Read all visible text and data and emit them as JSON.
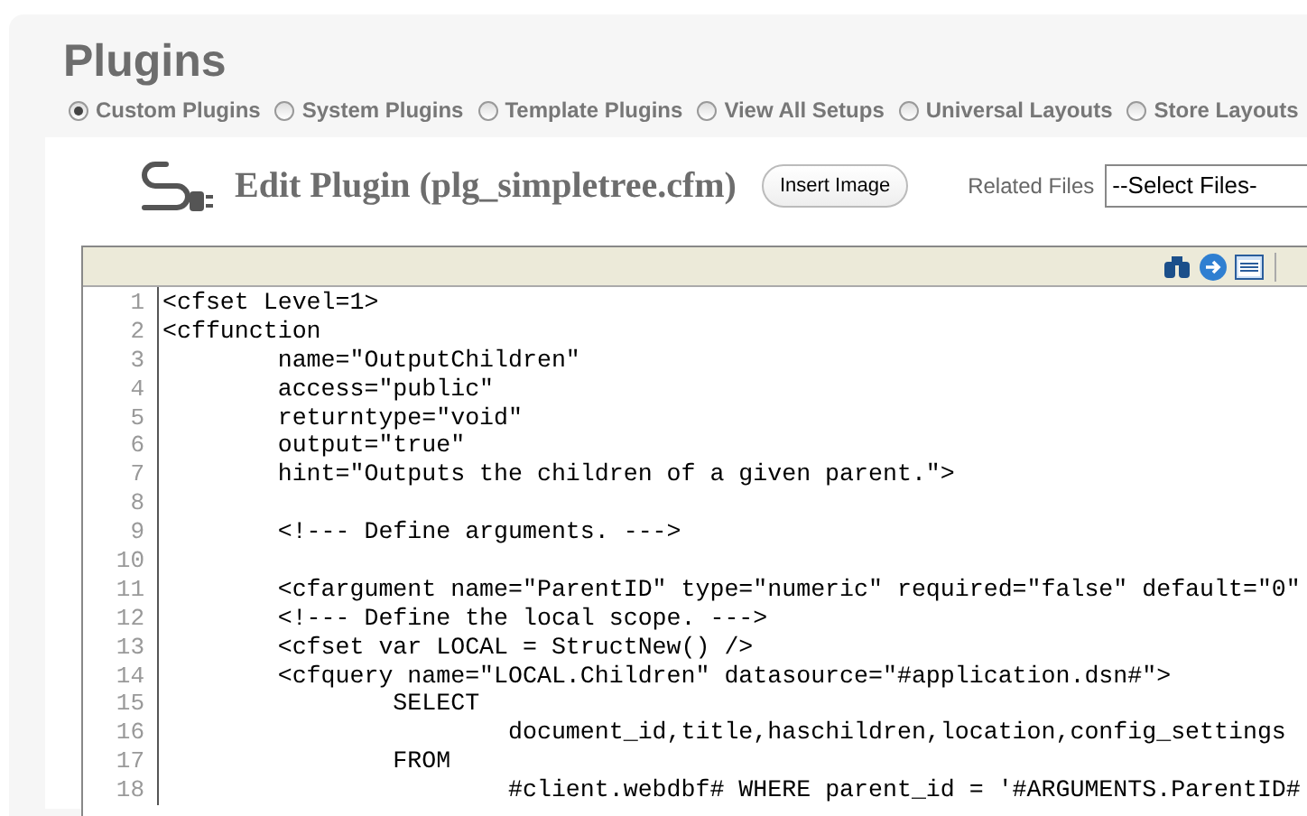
{
  "page_title": "Plugins",
  "plugin_types": [
    {
      "label": "Custom Plugins",
      "selected": true
    },
    {
      "label": "System Plugins",
      "selected": false
    },
    {
      "label": "Template Plugins",
      "selected": false
    },
    {
      "label": "View All Setups",
      "selected": false
    },
    {
      "label": "Universal Layouts",
      "selected": false
    },
    {
      "label": "Store Layouts",
      "selected": false
    }
  ],
  "editor_title": "Edit Plugin (plg_simpletree.cfm)",
  "insert_image_button": "Insert Image",
  "related_files": {
    "label": "Related Files",
    "value": "--Select Files-"
  },
  "code_lines": [
    {
      "number": "1",
      "text": "<cfset Level=1>"
    },
    {
      "number": "2",
      "text": "<cffunction"
    },
    {
      "number": "3",
      "text": "\tname=\"OutputChildren\""
    },
    {
      "number": "4",
      "text": "\taccess=\"public\""
    },
    {
      "number": "5",
      "text": "\treturntype=\"void\""
    },
    {
      "number": "6",
      "text": "\toutput=\"true\""
    },
    {
      "number": "7",
      "text": "\thint=\"Outputs the children of a given parent.\">"
    },
    {
      "number": "8"
    },
    {
      "number": "9",
      "text": "\t<!--- Define arguments. --->"
    },
    {
      "number": "10"
    },
    {
      "number": "11",
      "text": "\t<cfargument name=\"ParentID\" type=\"numeric\" required=\"false\" default=\"0\""
    },
    {
      "number": "12",
      "text": "\t<!--- Define the local scope. --->"
    },
    {
      "number": "13",
      "text": "\t<cfset var LOCAL = StructNew() />"
    },
    {
      "number": "14",
      "text": "\t<cfquery name=\"LOCAL.Children\" datasource=\"#application.dsn#\">"
    },
    {
      "number": "15",
      "text": "\t\tSELECT"
    },
    {
      "number": "16",
      "text": "\t\t\tdocument_id,title,haschildren,location,config_settings"
    },
    {
      "number": "17",
      "text": "\t\tFROM"
    },
    {
      "number": "18",
      "text": "\t\t\t#client.webdbf# WHERE parent_id = '#ARGUMENTS.ParentID#"
    }
  ]
}
